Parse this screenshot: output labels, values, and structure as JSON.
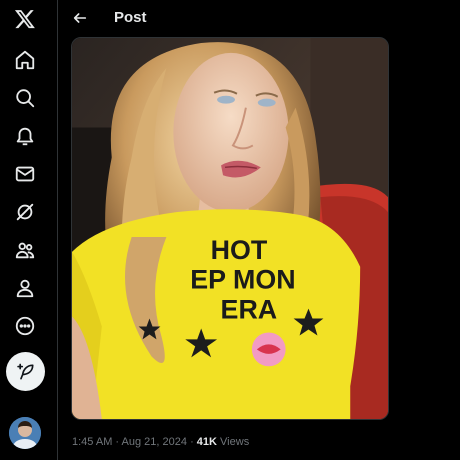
{
  "sidebar": {
    "items": [
      {
        "name": "x-logo"
      },
      {
        "name": "home"
      },
      {
        "name": "explore"
      },
      {
        "name": "notifications"
      },
      {
        "name": "messages"
      },
      {
        "name": "grok"
      },
      {
        "name": "communities"
      },
      {
        "name": "profile"
      },
      {
        "name": "more"
      }
    ],
    "compose_icon": "feather-plus-icon"
  },
  "header": {
    "title": "Post"
  },
  "media": {
    "shirt_text": [
      "HOT",
      "EP MON",
      "ERA"
    ]
  },
  "post": {
    "time": "1:45 AM",
    "separator": "·",
    "date": "Aug 21, 2024",
    "views_count": "41K",
    "views_label": "Views"
  }
}
